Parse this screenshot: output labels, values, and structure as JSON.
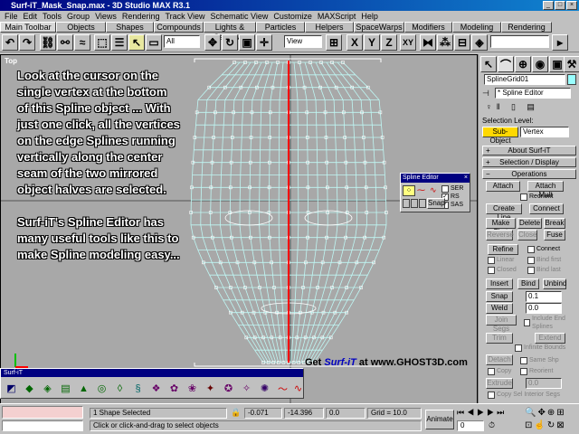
{
  "window": {
    "title": "Surf-iT_Mask_Snap.max - 3D Studio MAX R3.1"
  },
  "menu": [
    "File",
    "Edit",
    "Tools",
    "Group",
    "Views",
    "Rendering",
    "Track View",
    "Schematic View",
    "Customize",
    "MAXScript",
    "Help"
  ],
  "tabs": [
    "Main Toolbar",
    "Objects",
    "Shapes",
    "Compounds",
    "Lights & Cameras",
    "Particles",
    "Helpers",
    "SpaceWarps",
    "Modifiers",
    "Modeling",
    "Rendering"
  ],
  "toolbar": {
    "selection_filter": "All",
    "ref_coord": "View",
    "axis_x": "X",
    "axis_y": "Y",
    "axis_z": "Z",
    "axis_xy": "XY"
  },
  "viewport": {
    "label": "Top",
    "overlay_text": [
      "Look at the cursor on the single vertex at the bottom of this Spline object ... With just one click, all the vertices on the edge Splines running vertically along the center seam of the two mirrored object halves are selected.",
      "Surf-iT's Spline Editor has many useful tools like this to make Spline modeling easy..."
    ],
    "promo_prefix": "Get ",
    "promo_brand": "Surf-iT",
    "promo_suffix": " at www.GHOST3D.com"
  },
  "spline_editor": {
    "title": "Spline Editor",
    "snap": "Snap",
    "ser": "SER",
    "rs": "RS",
    "sas": "SAS"
  },
  "command_panel": {
    "object_name": "SplineGrid01",
    "modifier": "* Spline Editor",
    "selection_level_label": "Selection Level:",
    "sub_object": "Sub-Object",
    "level": "Vertex",
    "rollouts": {
      "about": "About Surf-iT",
      "selection": "Selection / Display",
      "operations": "Operations"
    },
    "buttons": {
      "attach": "Attach",
      "attach_mult": "Attach Mult",
      "reorient": "Reorient",
      "create_line": "Create Line",
      "connect": "Connect",
      "make_first": "Make First",
      "delete": "Delete",
      "break": "Break",
      "reverse": "Reverse",
      "close": "Close",
      "fuse": "Fuse",
      "refine": "Refine",
      "connect_cb": "Connect",
      "linear": "Linear",
      "bind_first": "Bind first",
      "closed": "Closed",
      "bind_last": "Bind last",
      "insert": "Insert",
      "bind": "Bind",
      "unbind": "Unbind",
      "snap": "Snap",
      "snap_val": "0.1",
      "weld": "Weld",
      "weld_val": "0.0",
      "join_segs": "Join Segs",
      "include_end": "Include End Splines",
      "trim": "Trim",
      "extend": "Extend",
      "infinite_bounds": "Infinite Bounds",
      "detach": "Detach",
      "same_shp": "Same Shp",
      "copy": "Copy",
      "reorient2": "Reorient",
      "extrude": "Extrude",
      "extrude_val": "0.0",
      "copy_sel": "Copy Sel Interior Segs"
    }
  },
  "surf_toolbar": {
    "title": "Surf-iT"
  },
  "status": {
    "selected": "1 Shape Selected",
    "prompt": "Click or click-and-drag to select objects",
    "x": "-0.071",
    "y": "-14.396",
    "z": "0.0",
    "grid": "Grid = 10.0",
    "animate": "Animate",
    "frame": "0"
  }
}
